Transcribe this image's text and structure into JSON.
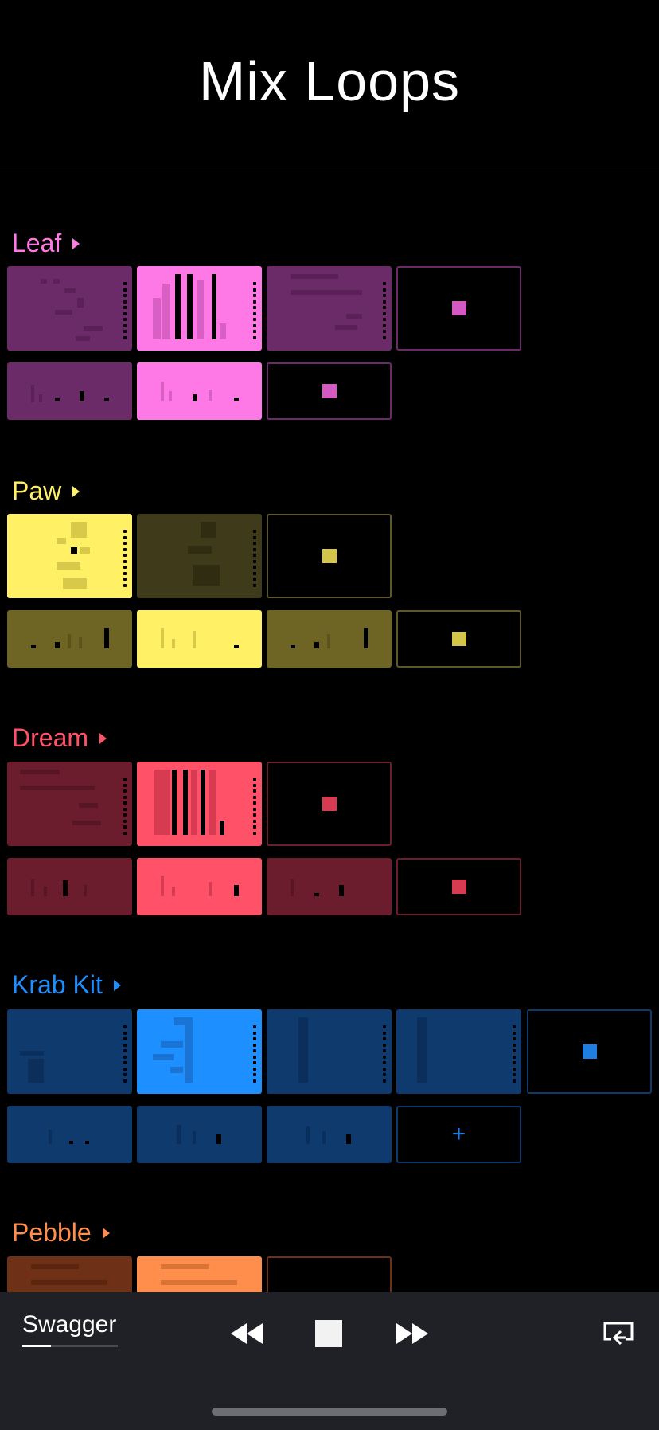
{
  "title": "Mix Loops",
  "groups": [
    {
      "name": "Leaf",
      "color": "#ff79e6",
      "dim": "#6b2a68",
      "accent": "#d459c0"
    },
    {
      "name": "Paw",
      "color": "#fff066",
      "dim": "#5e5728",
      "accent": "#d3c44a"
    },
    {
      "name": "Dream",
      "color": "#ff5269",
      "dim": "#6b1d2d",
      "accent": "#d63b51"
    },
    {
      "name": "Krab Kit",
      "color": "#1e8fff",
      "dim": "#0f3a6e",
      "accent": "#1e7fe0"
    },
    {
      "name": "Pebble",
      "color": "#ff8e4d",
      "dim": "#6e3016",
      "accent": "#d77435"
    }
  ],
  "add_label": "+",
  "player": {
    "song": "Swagger",
    "controls": [
      "rewind",
      "stop",
      "fast-forward",
      "airplay"
    ]
  }
}
